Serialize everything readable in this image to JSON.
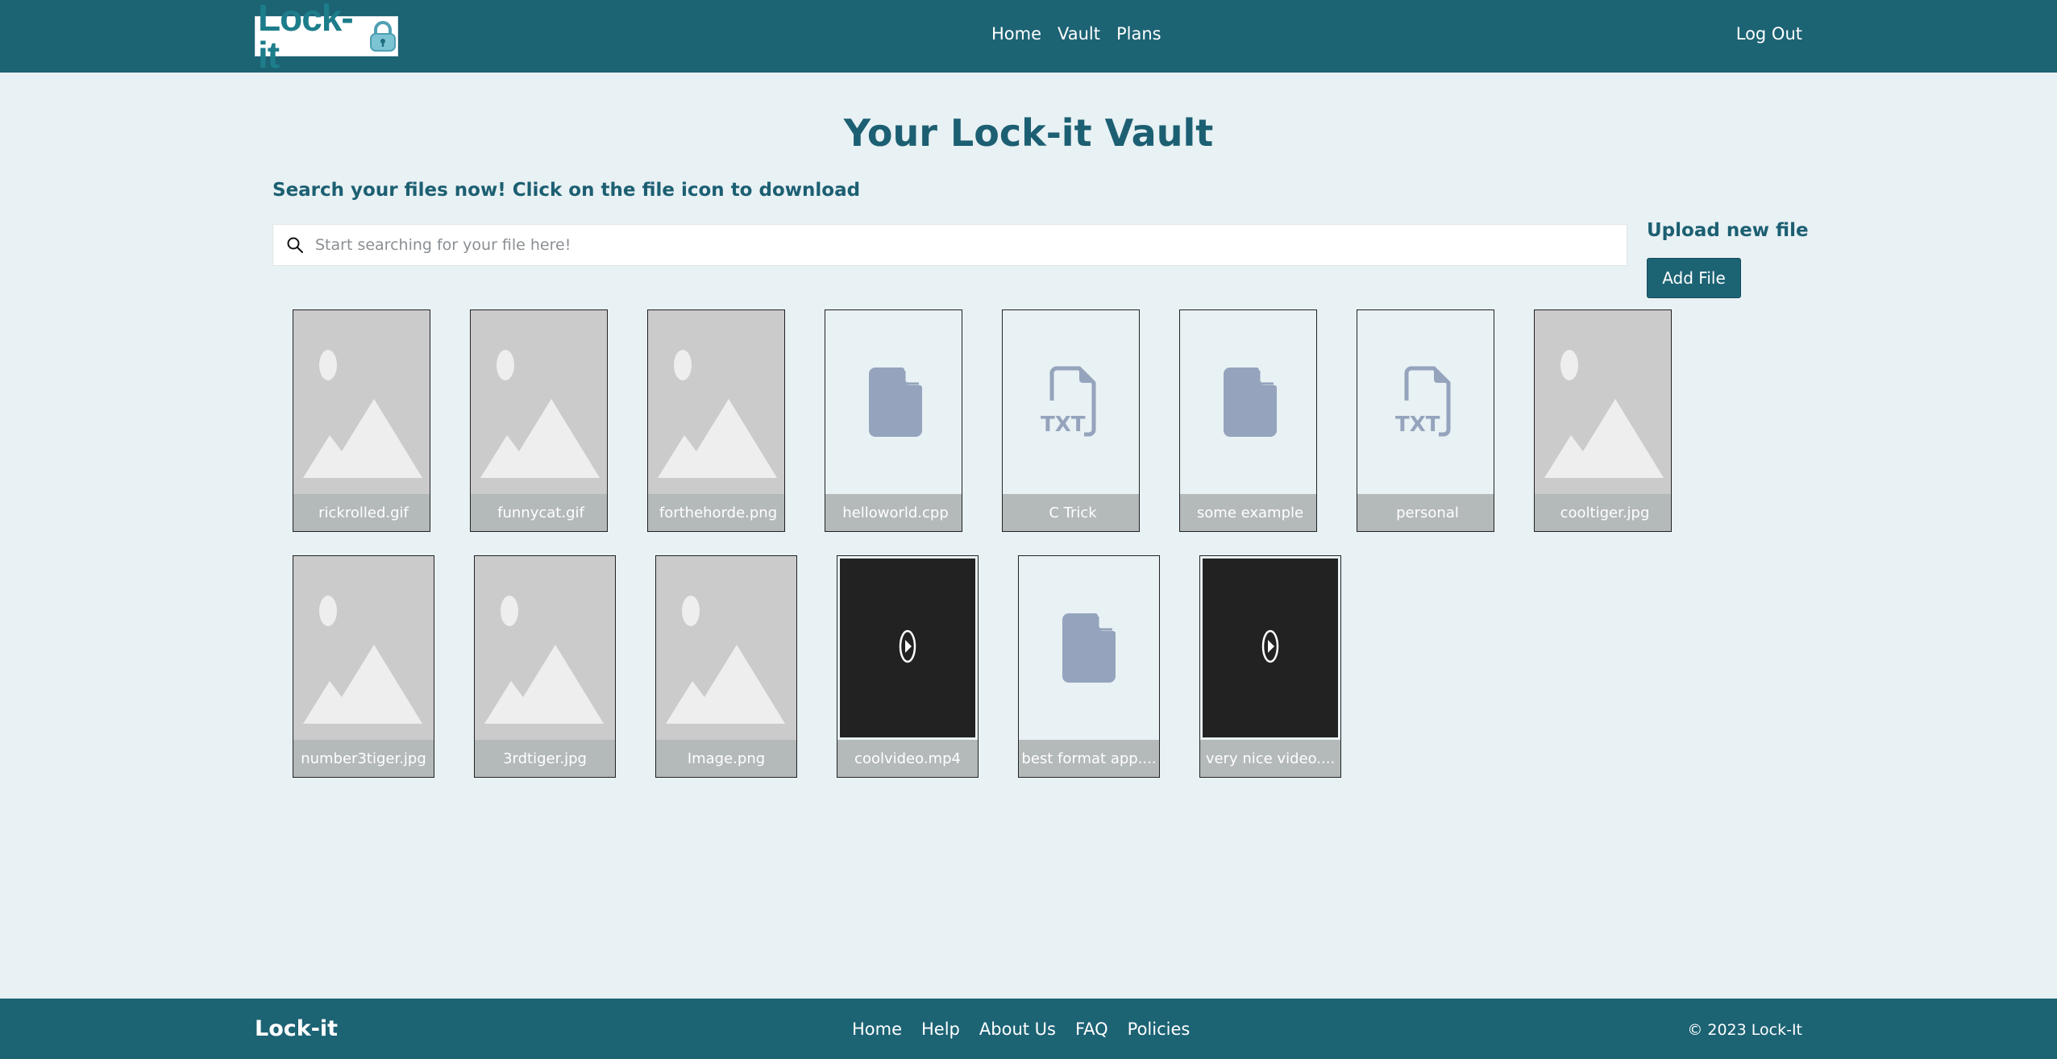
{
  "brand": {
    "logo_text": "Lock-it",
    "accent_color": "#1c6374"
  },
  "nav": {
    "home": "Home",
    "vault": "Vault",
    "plans": "Plans",
    "logout": "Log Out"
  },
  "main": {
    "title": "Your Lock-it Vault",
    "search_heading": "Search your files now! Click on the file icon to download",
    "search_placeholder": "Start searching for your file here!",
    "upload_heading": "Upload new file",
    "add_file_label": "Add File"
  },
  "files": [
    {
      "name": "rickrolled.gif",
      "kind": "image"
    },
    {
      "name": "funnycat.gif",
      "kind": "image"
    },
    {
      "name": "forthehorde.png",
      "kind": "image"
    },
    {
      "name": "helloworld.cpp",
      "kind": "file"
    },
    {
      "name": "C Trick",
      "kind": "txt"
    },
    {
      "name": "some example",
      "kind": "file"
    },
    {
      "name": "personal",
      "kind": "txt"
    },
    {
      "name": "cooltiger.jpg",
      "kind": "image"
    },
    {
      "name": "number3tiger.jpg",
      "kind": "image"
    },
    {
      "name": "3rdtiger.jpg",
      "kind": "image"
    },
    {
      "name": "Image.png",
      "kind": "image"
    },
    {
      "name": "coolvideo.mp4",
      "kind": "video"
    },
    {
      "name": "best format app....",
      "kind": "file"
    },
    {
      "name": "very nice video....",
      "kind": "video"
    }
  ],
  "footer": {
    "brand": "Lock-it",
    "links": [
      "Home",
      "Help",
      "About Us",
      "FAQ",
      "Policies"
    ],
    "copyright": "© 2023 Lock-It"
  }
}
